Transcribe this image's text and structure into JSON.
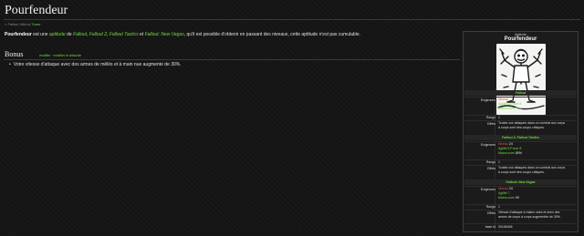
{
  "page": {
    "title": "Pourfendeur",
    "breadcrumb_prefix": "< Fallout Wiki:ia",
    "breadcrumb_link": "Tuner",
    "intro": {
      "subject": "Pourfendeur",
      "t1": " est une ",
      "l1": "aptitude",
      "t2": " de ",
      "l2": "Fallout",
      "t3": ", ",
      "l3": "Fallout 2",
      "t4": ", ",
      "l4": "Fallout Tactics",
      "t5": " et ",
      "l5": "Fallout: New Vegas",
      "t6": ", qu'il est possible d'obtenir en passant des niveaux, cette aptitude n'est pas cumulable."
    },
    "section": {
      "heading": "Bonus",
      "edit_label": "modifier · modifier le wikicode",
      "bullet": "Votre vitesse d'attaque avec des armes de mêlés et à main nue augmente de 30%."
    }
  },
  "infobox": {
    "type_label": "Aptitude",
    "name": "Pourfendeur",
    "sections": [
      {
        "game": "Fallout",
        "req_label": "Exigences",
        "req": [
          {
            "a": "Niveau",
            "b": " 15"
          },
          {
            "a": "Agilité 8",
            "b": " Force 8"
          },
          {
            "a": "Mains nues",
            "b": " 80%"
          }
        ],
        "rank_label": "Rangs",
        "rank": "1",
        "fx_label": "Effets",
        "fx1": "Toutes vos attaques dans un combat aux corps",
        "fx2": "à corps sont des coups critiques."
      },
      {
        "game": "Fallout 2, Fallout Tactics",
        "req_label": "Exigences",
        "req": [
          {
            "a": "Niveau",
            "b": " 24"
          },
          {
            "a": "Agilité 8",
            "b": " Force 8"
          },
          {
            "a": "Mains nues",
            "b": " 80%"
          }
        ],
        "rank_label": "Rangs",
        "rank": "1",
        "fx_label": "Effets",
        "fx1": "Toutes vos attaques dans un combat aux corps",
        "fx2": "à corps sont des coups critiques."
      },
      {
        "game": "Fallout: New Vegas",
        "req_label": "Exigences",
        "req": [
          {
            "a": "Niveau",
            "b": " 24"
          },
          {
            "a": "Agilité 7",
            "b": ""
          },
          {
            "a": "Mains nues",
            "b": " 90"
          }
        ],
        "rank_label": "Rangs",
        "rank": "1",
        "fx_label": "Effets",
        "fx1": "Vitesse d'attaque à mains nues et avec des",
        "fx2": "armes de corps à corps augmentée de 30%"
      }
    ],
    "base_id_label": "base id",
    "base_id": "00165446"
  },
  "colors": {
    "background": "#141414",
    "link": "#6fdc3a",
    "requirement": "#e05050",
    "text": "#dcdcdc"
  }
}
